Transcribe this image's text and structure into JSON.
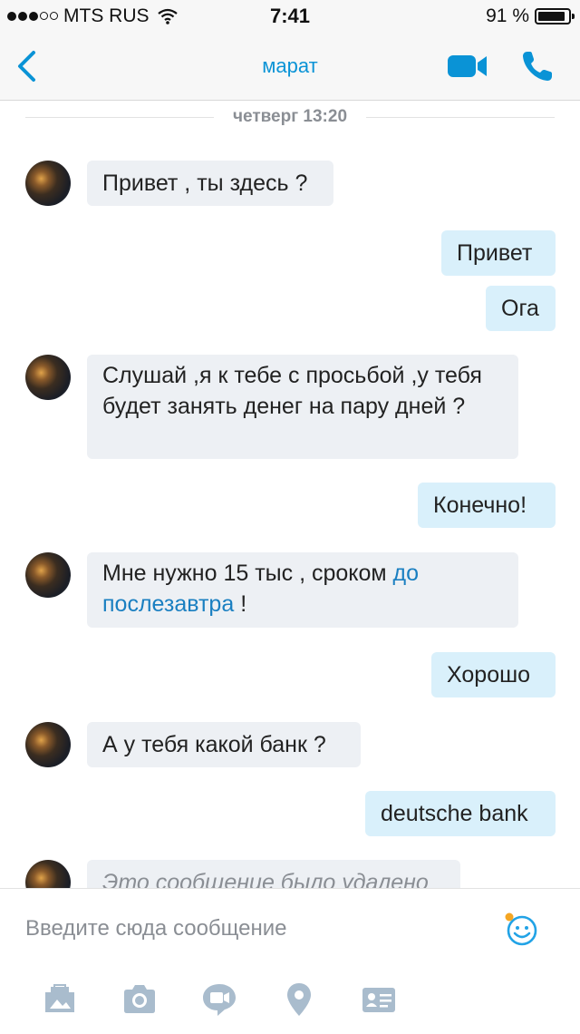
{
  "status_bar": {
    "carrier": "MTS RUS",
    "time": "7:41",
    "battery": "91 %",
    "battery_level": 0.91
  },
  "nav": {
    "title": "марат"
  },
  "chat": {
    "date_divider": "четверг 13:20",
    "messages": [
      {
        "dir": "in",
        "text": "Привет , ты здесь ?"
      },
      {
        "dir": "out",
        "text": "Привет"
      },
      {
        "dir": "out",
        "text": "Ога"
      },
      {
        "dir": "in",
        "text": "Слушай ,я к тебе с просьбой ,у тебя будет занять денег на пару дней ?"
      },
      {
        "dir": "out",
        "text": "Конечно!"
      },
      {
        "dir": "in",
        "text_before": "Мне нужно 15 тыс , сроком ",
        "link_text": "до послезавтра",
        "text_after": " !"
      },
      {
        "dir": "out",
        "text": "Хорошо"
      },
      {
        "dir": "in",
        "text": "А у тебя какой банк ?"
      },
      {
        "dir": "out",
        "text": "deutsche bank"
      },
      {
        "dir": "in",
        "text": "Это сообщение было удалено",
        "deleted": true
      }
    ]
  },
  "composer": {
    "placeholder": "Введите сюда сообщение"
  },
  "toolbar": {
    "icons": [
      "media-icon",
      "camera-icon",
      "video-message-icon",
      "location-icon",
      "contact-card-icon"
    ]
  },
  "colors": {
    "accent": "#0a93d6",
    "incoming_bubble": "#edf0f4",
    "outgoing_bubble": "#d9f0fb"
  }
}
